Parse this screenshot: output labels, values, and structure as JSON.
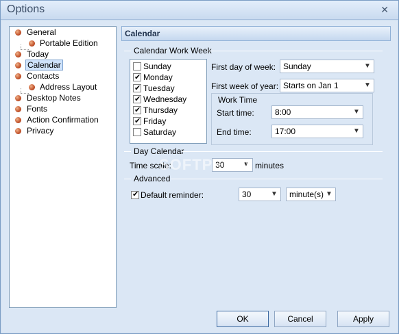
{
  "window": {
    "title": "Options",
    "close_glyph": "✕"
  },
  "tree": {
    "items": [
      {
        "label": "General"
      },
      {
        "label": "Portable Edition"
      },
      {
        "label": "Today"
      },
      {
        "label": "Calendar"
      },
      {
        "label": "Contacts"
      },
      {
        "label": "Address Layout"
      },
      {
        "label": "Desktop Notes"
      },
      {
        "label": "Fonts"
      },
      {
        "label": "Action Confirmation"
      },
      {
        "label": "Privacy"
      }
    ],
    "selected": "Calendar"
  },
  "panel": {
    "header": "Calendar",
    "work_week": {
      "title": "Calendar Work Week",
      "days": [
        {
          "label": "Sunday",
          "checked": false
        },
        {
          "label": "Monday",
          "checked": true
        },
        {
          "label": "Tuesday",
          "checked": true
        },
        {
          "label": "Wednesday",
          "checked": true
        },
        {
          "label": "Thursday",
          "checked": true
        },
        {
          "label": "Friday",
          "checked": true
        },
        {
          "label": "Saturday",
          "checked": false
        }
      ],
      "first_day_label": "First day of week:",
      "first_day_value": "Sunday",
      "first_week_label": "First week of year:",
      "first_week_value": "Starts on Jan 1",
      "work_time": {
        "title": "Work Time",
        "start_label": "Start time:",
        "start_value": "8:00",
        "end_label": "End time:",
        "end_value": "17:00"
      }
    },
    "day_calendar": {
      "title": "Day Calendar",
      "time_scale_label": "Time scale:",
      "time_scale_value": "30",
      "time_scale_unit": "minutes"
    },
    "advanced": {
      "title": "Advanced",
      "reminder_label": "Default reminder:",
      "reminder_checked": true,
      "reminder_value": "30",
      "reminder_unit": "minute(s)"
    }
  },
  "buttons": {
    "ok": "OK",
    "cancel": "Cancel",
    "apply": "Apply"
  },
  "watermark": "SOFTPEDIA",
  "icons": {
    "tree_bullet": "bullet-icon",
    "dropdown": "chevron-down-icon",
    "check": "checkbox-check-icon"
  }
}
